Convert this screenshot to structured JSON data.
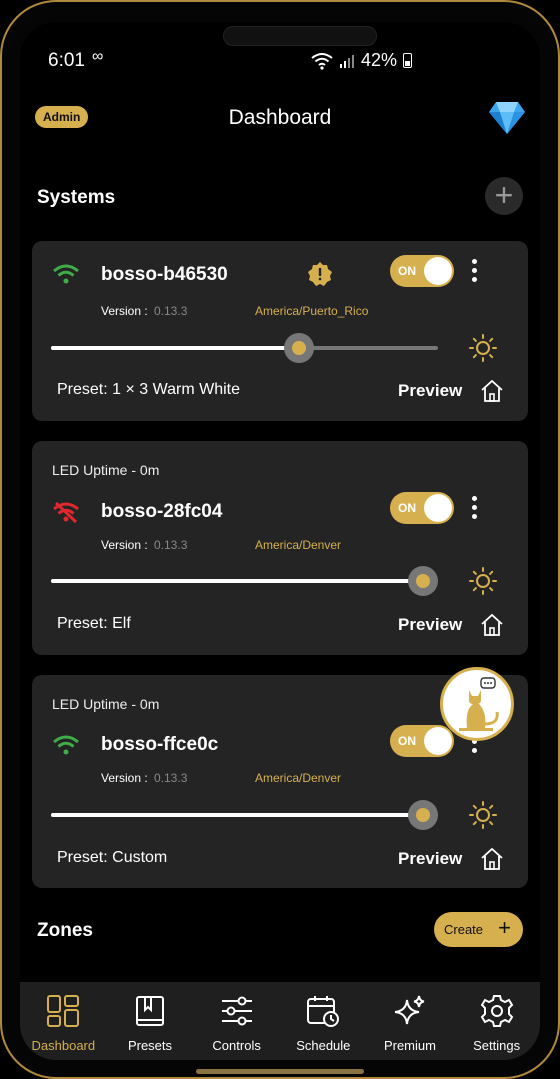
{
  "status_bar": {
    "time": "6:01",
    "voicemail_icon": "voicemail-icon",
    "battery": "42%"
  },
  "header": {
    "badge": "Admin",
    "title": "Dashboard"
  },
  "systems": {
    "title": "Systems",
    "devices": [
      {
        "uptime": "",
        "name": "bosso-b46530",
        "wifi_status": "connected",
        "has_warning": true,
        "toggle_label": "ON",
        "version_label": "Version :",
        "version": "0.13.3",
        "timezone": "America/Puerto_Rico",
        "brightness_pct": 64,
        "preset": "Preset: 1 × 3 Warm White",
        "preview": "Preview"
      },
      {
        "uptime": "LED Uptime - 0m",
        "name": "bosso-28fc04",
        "wifi_status": "disconnected",
        "has_warning": false,
        "toggle_label": "ON",
        "version_label": "Version :",
        "version": "0.13.3",
        "timezone": "America/Denver",
        "brightness_pct": 96,
        "preset": "Preset: Elf",
        "preview": "Preview"
      },
      {
        "uptime": "LED Uptime - 0m",
        "name": "bosso-ffce0c",
        "wifi_status": "connected",
        "has_warning": false,
        "toggle_label": "ON",
        "version_label": "Version :",
        "version": "0.13.3",
        "timezone": "America/Denver",
        "brightness_pct": 96,
        "preset": "Preset: Custom",
        "preview": "Preview"
      }
    ]
  },
  "zones": {
    "title": "Zones",
    "create_label": "Create"
  },
  "nav": [
    {
      "label": "Dashboard",
      "icon": "dashboard-icon",
      "active": true
    },
    {
      "label": "Presets",
      "icon": "presets-icon",
      "active": false
    },
    {
      "label": "Controls",
      "icon": "controls-icon",
      "active": false
    },
    {
      "label": "Schedule",
      "icon": "schedule-icon",
      "active": false
    },
    {
      "label": "Premium",
      "icon": "premium-icon",
      "active": false
    },
    {
      "label": "Settings",
      "icon": "settings-icon",
      "active": false
    }
  ],
  "colors": {
    "accent": "#d6b04f",
    "card": "#242424",
    "wifi_ok": "#3fae49",
    "wifi_off": "#e0282e"
  }
}
